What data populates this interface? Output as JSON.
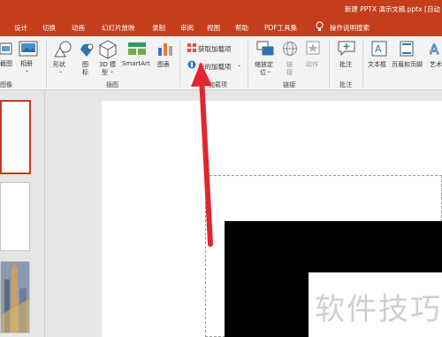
{
  "window": {
    "title": "新建 PPTX 演示文稿.pptx [自动"
  },
  "tabs": [
    "设计",
    "切换",
    "动画",
    "幻灯片放映",
    "录制",
    "审阅",
    "视图",
    "帮助",
    "PDF工具集",
    "操作说明搜索"
  ],
  "ribbon": {
    "partial_left_1": "截图",
    "partial_left_2": "像",
    "album": "相册",
    "shapes": "形状",
    "icons_1": "图",
    "icons_2": "标",
    "models_1": "3D 模",
    "models_2": "型",
    "smartart": "SmartArt",
    "chart": "图表",
    "get_addins": "获取加载项",
    "my_addins": "我的加载项",
    "zoom_1": "缩放定",
    "zoom_2": "位",
    "link_1": "链",
    "link_2": "接",
    "action": "动作",
    "comment": "批注",
    "textbox": "文本框",
    "header_footer": "页眉和页脚",
    "wordart": "艺术"
  },
  "groups": {
    "images": "图像",
    "illustrations": "插图",
    "addins": "加载项",
    "links": "链接",
    "comments": "批注"
  },
  "watermark": "软件技巧",
  "colors": {
    "accent": "#c43e1c",
    "arrow": "#e0262e"
  }
}
